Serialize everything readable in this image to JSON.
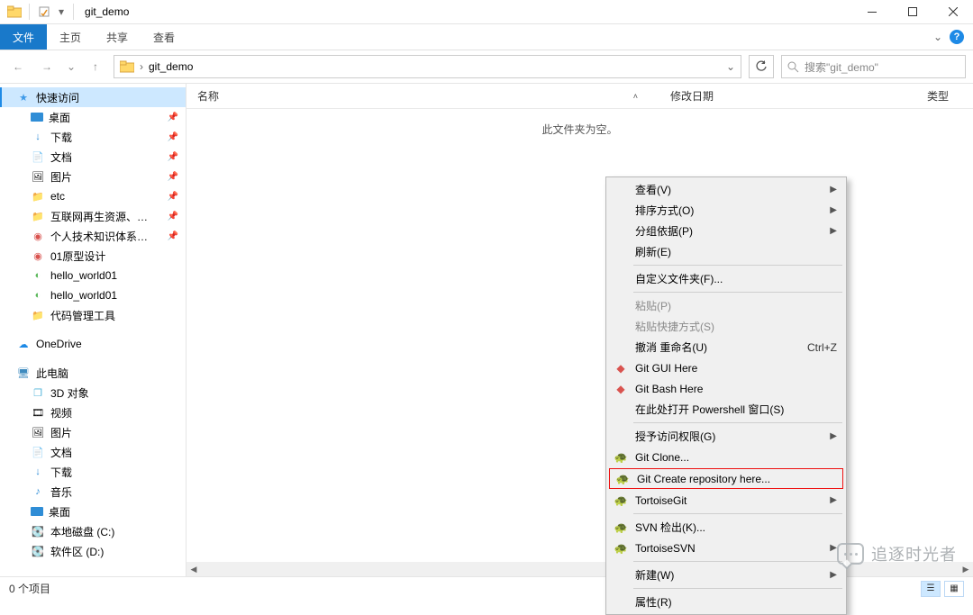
{
  "window": {
    "title": "git_demo"
  },
  "ribbon": {
    "file": "文件",
    "tabs": [
      "主页",
      "共享",
      "查看"
    ]
  },
  "nav": {
    "breadcrumb_root": "git_demo",
    "search_placeholder": "搜索\"git_demo\""
  },
  "columns": {
    "name": "名称",
    "date": "修改日期",
    "type": "类型"
  },
  "empty_folder": "此文件夹为空。",
  "sidebar": {
    "quick_access": "快速访问",
    "items": {
      "desktop": "桌面",
      "downloads": "下载",
      "documents": "文档",
      "pictures": "图片",
      "etc": "etc",
      "internet": "互联网再生资源、废品回收",
      "personal": "个人技术知识体系@吴川生",
      "proto": "01原型设计",
      "hw1": "hello_world01",
      "hw2": "hello_world01",
      "code_mg": "代码管理工具"
    },
    "onedrive": "OneDrive",
    "this_pc": "此电脑",
    "pc_items": {
      "objects3d": "3D 对象",
      "videos": "视频",
      "pictures": "图片",
      "documents": "文档",
      "downloads": "下载",
      "music": "音乐",
      "desktop": "桌面",
      "local_c": "本地磁盘 (C:)",
      "soft_d": "软件区 (D:)"
    }
  },
  "context_menu": {
    "view": "查看(V)",
    "sort": "排序方式(O)",
    "group": "分组依据(P)",
    "refresh": "刷新(E)",
    "customize": "自定义文件夹(F)...",
    "paste": "粘贴(P)",
    "paste_shortcut": "粘贴快捷方式(S)",
    "undo_rename": "撤消 重命名(U)",
    "undo_shortcut": "Ctrl+Z",
    "git_gui": "Git GUI Here",
    "git_bash": "Git Bash Here",
    "powershell": "在此处打开 Powershell 窗口(S)",
    "access": "授予访问权限(G)",
    "git_clone": "Git Clone...",
    "git_create": "Git Create repository here...",
    "tortoise_git": "TortoiseGit",
    "svn_checkout": "SVN 检出(K)...",
    "tortoise_svn": "TortoiseSVN",
    "new": "新建(W)",
    "properties": "属性(R)"
  },
  "status": {
    "items": "0 个项目"
  },
  "watermark": "追逐时光者"
}
